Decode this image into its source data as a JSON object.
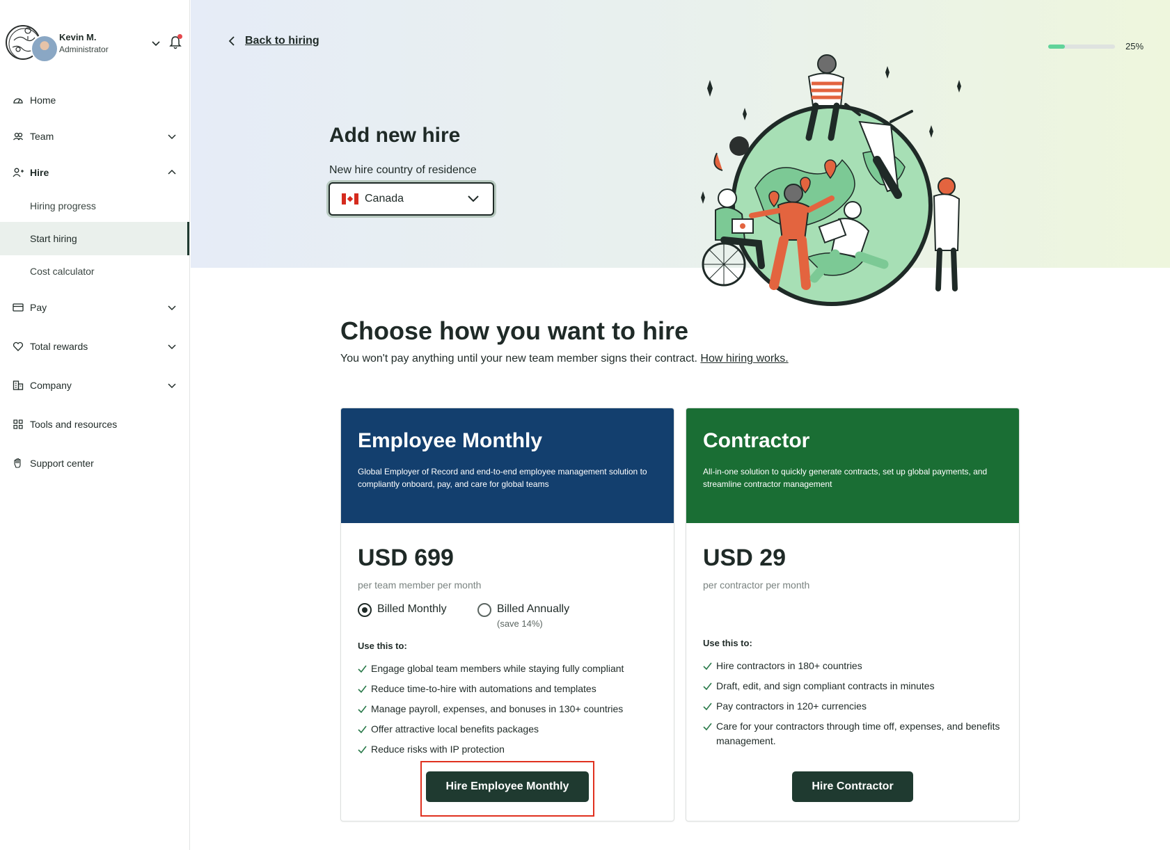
{
  "user": {
    "name": "Kevin M.",
    "role": "Administrator"
  },
  "sidebar": {
    "items": [
      {
        "label": "Home",
        "icon": "home-gauge-icon"
      },
      {
        "label": "Team",
        "icon": "team-icon"
      },
      {
        "label": "Hire",
        "icon": "add-person-icon"
      },
      {
        "label": "Pay",
        "icon": "card-icon"
      },
      {
        "label": "Total rewards",
        "icon": "heart-icon"
      },
      {
        "label": "Company",
        "icon": "building-icon"
      },
      {
        "label": "Tools and resources",
        "icon": "grid-icon"
      },
      {
        "label": "Support center",
        "icon": "hand-icon"
      }
    ],
    "hire_sub": [
      "Hiring progress",
      "Start hiring",
      "Cost calculator"
    ]
  },
  "header": {
    "back_label": "Back to hiring",
    "progress_label": "25%",
    "progress_value": 0.25
  },
  "hero": {
    "title": "Add new hire",
    "country_label": "New hire country of residence",
    "country_value": "Canada"
  },
  "main": {
    "title": "Choose how you want to hire",
    "subtitle": "You won't pay anything until your new team member signs their contract.",
    "subtitle_link": "How hiring works."
  },
  "cards": {
    "employee": {
      "title": "Employee Monthly",
      "description": "Global Employer of Record and end-to-end employee management solution to compliantly onboard, pay, and care for global teams",
      "price": "USD 699",
      "price_sub": "per team member per month",
      "billing_monthly": "Billed Monthly",
      "billing_annually": "Billed Annually",
      "billing_annually_sub": "(save 14%)",
      "use_title": "Use this to:",
      "features": [
        "Engage global team members while staying fully compliant",
        "Reduce time-to-hire with automations and templates",
        "Manage payroll, expenses, and bonuses in 130+ countries",
        "Offer attractive local benefits packages",
        "Reduce risks with IP protection"
      ],
      "cta": "Hire Employee Monthly",
      "color": "#133f6e"
    },
    "contractor": {
      "title": "Contractor",
      "description": "All-in-one solution to quickly generate contracts, set up global payments, and streamline contractor management",
      "price": "USD 29",
      "price_sub": "per contractor per month",
      "use_title": "Use this to:",
      "features": [
        "Hire contractors in 180+ countries",
        "Draft, edit, and sign compliant contracts in minutes",
        "Pay contractors in 120+ currencies",
        "Care for your contractors through time off, expenses, and benefits management."
      ],
      "cta": "Hire Contractor",
      "color": "#1a6e34"
    }
  },
  "colors": {
    "cta": "#1f3a30",
    "accent_progress": "#61d39a",
    "highlight": "#e0311f"
  }
}
